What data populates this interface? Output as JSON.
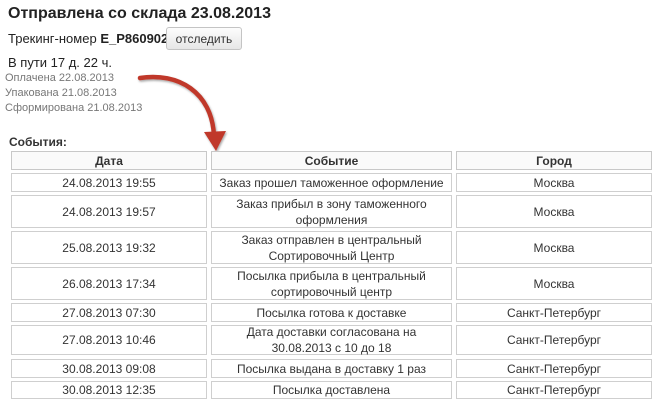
{
  "title": "Отправлена со склада 23.08.2013",
  "tracking": {
    "label": "Трекинг-номер",
    "number": "E_P860902",
    "button_label": "отследить"
  },
  "transit_time": "В пути 17 д. 22 ч.",
  "history": [
    "Оплачена 22.08.2013",
    "Упакована 21.08.2013",
    "Сформирована 21.08.2013"
  ],
  "events_label": "События:",
  "table": {
    "headers": [
      "Дата",
      "Событие",
      "Город"
    ],
    "rows": [
      [
        "24.08.2013 19:55",
        "Заказ прошел таможенное оформление",
        "Москва"
      ],
      [
        "24.08.2013 19:57",
        "Заказ прибыл в зону таможенного оформления",
        "Москва"
      ],
      [
        "25.08.2013 19:32",
        "Заказ отправлен в центральный Сортировочный Центр",
        "Москва"
      ],
      [
        "26.08.2013 17:34",
        "Посылка прибыла в центральный сортировочный центр",
        "Москва"
      ],
      [
        "27.08.2013 07:30",
        "Посылка готова к доставке",
        "Санкт-Петербург"
      ],
      [
        "27.08.2013 10:46",
        "Дата доставки согласована на 30.08.2013 с 10 до 18",
        "Санкт-Петербург"
      ],
      [
        "30.08.2013 09:08",
        "Посылка выдана в доставку 1 раз",
        "Санкт-Петербург"
      ],
      [
        "30.08.2013 12:35",
        "Посылка доставлена",
        "Санкт-Петербург"
      ]
    ]
  },
  "colors": {
    "arrow": "#c0392b",
    "border": "#cfcfcf"
  }
}
